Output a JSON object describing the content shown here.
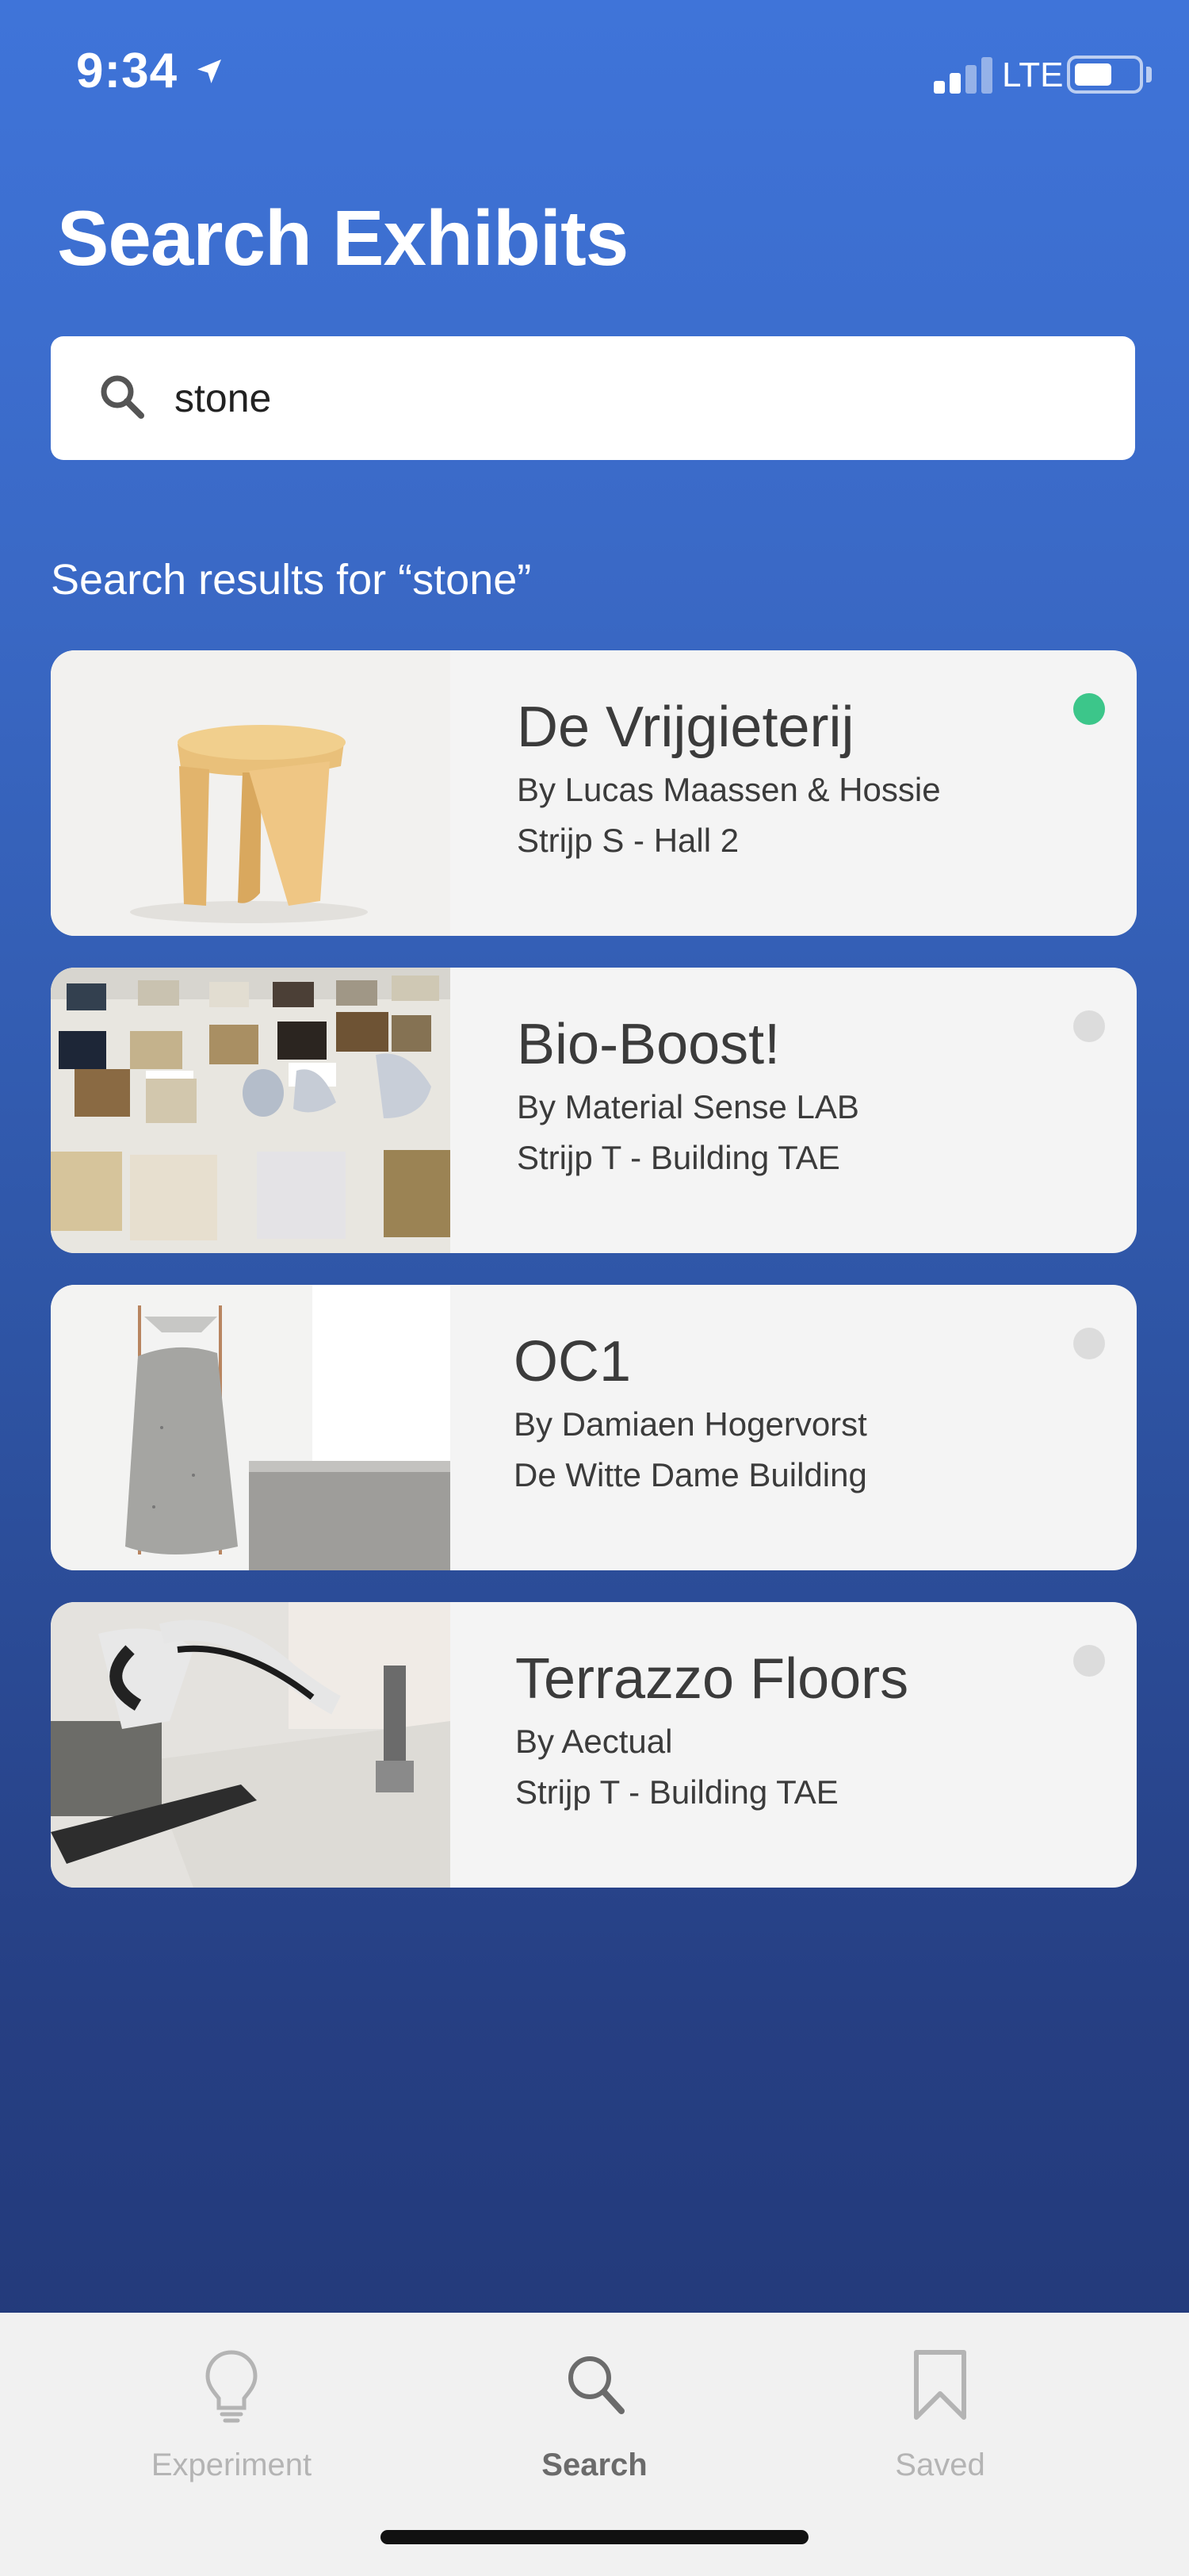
{
  "status_bar": {
    "time": "9:34",
    "network": "LTE",
    "signal_bars": 2,
    "battery_level": 0.55
  },
  "header": {
    "title": "Search Exhibits"
  },
  "search": {
    "value": "stone",
    "icon": "search-icon"
  },
  "results": {
    "heading": "Search results for “stone”",
    "items": [
      {
        "title": "De Vrijgieterij",
        "author": "By Lucas Maassen & Hossie",
        "location": "Strijp S - Hall 2",
        "status": "active"
      },
      {
        "title": "Bio-Boost!",
        "author": "By Material Sense LAB",
        "location": "Strijp T - Building TAE",
        "status": "inactive"
      },
      {
        "title": "OC1",
        "author": "By Damiaen Hogervorst",
        "location": "De Witte Dame Building",
        "status": "inactive"
      },
      {
        "title": "Terrazzo Floors",
        "author": "By Aectual",
        "location": "Strijp T - Building TAE",
        "status": "inactive"
      }
    ]
  },
  "tab_bar": {
    "tabs": [
      {
        "label": "Experiment",
        "icon": "lightbulb-icon",
        "active": false
      },
      {
        "label": "Search",
        "icon": "search-icon",
        "active": true
      },
      {
        "label": "Saved",
        "icon": "bookmark-icon",
        "active": false
      }
    ]
  },
  "colors": {
    "background_top": "#3f74d9",
    "background_bottom": "#213775",
    "status_active": "#3cc68a",
    "status_inactive": "#dcdcdc",
    "card_background": "#f4f4f4"
  }
}
